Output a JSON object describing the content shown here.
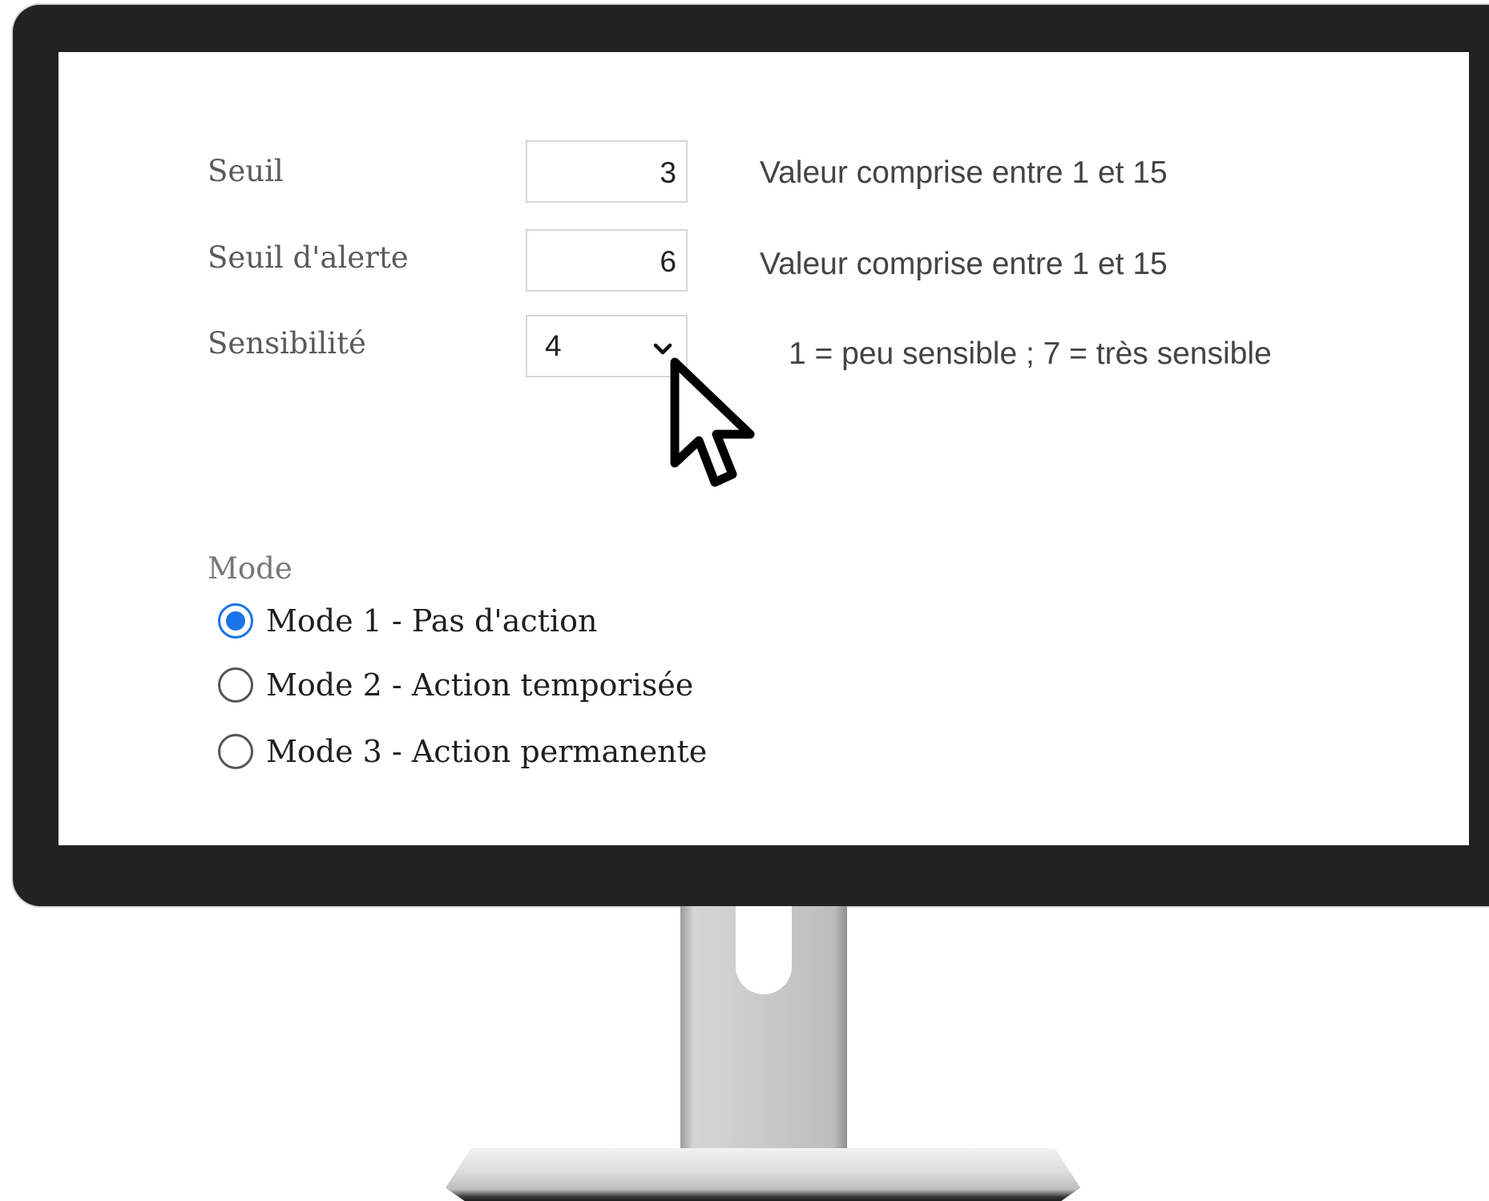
{
  "settings": {
    "seuil": {
      "label": "Seuil",
      "value": "3",
      "hint": "Valeur comprise entre 1 et 15"
    },
    "seuil_alerte": {
      "label": "Seuil d'alerte",
      "value": "6",
      "hint": "Valeur comprise entre 1 et 15"
    },
    "sensibilite": {
      "label": "Sensibilité",
      "selected": "4",
      "hint": "1 = peu sensible ; 7 = très sensible"
    }
  },
  "mode": {
    "title": "Mode",
    "options": [
      {
        "label": "Mode 1 - Pas d'action",
        "checked": true
      },
      {
        "label": "Mode 2 - Action temporisée",
        "checked": false
      },
      {
        "label": "Mode 3 - Action permanente",
        "checked": false
      }
    ]
  },
  "colors": {
    "accent": "#1a73e8",
    "bezel": "#222222"
  },
  "icons": {
    "select_chevron": "chevron-down-icon",
    "pointer": "mouse-pointer-icon"
  }
}
